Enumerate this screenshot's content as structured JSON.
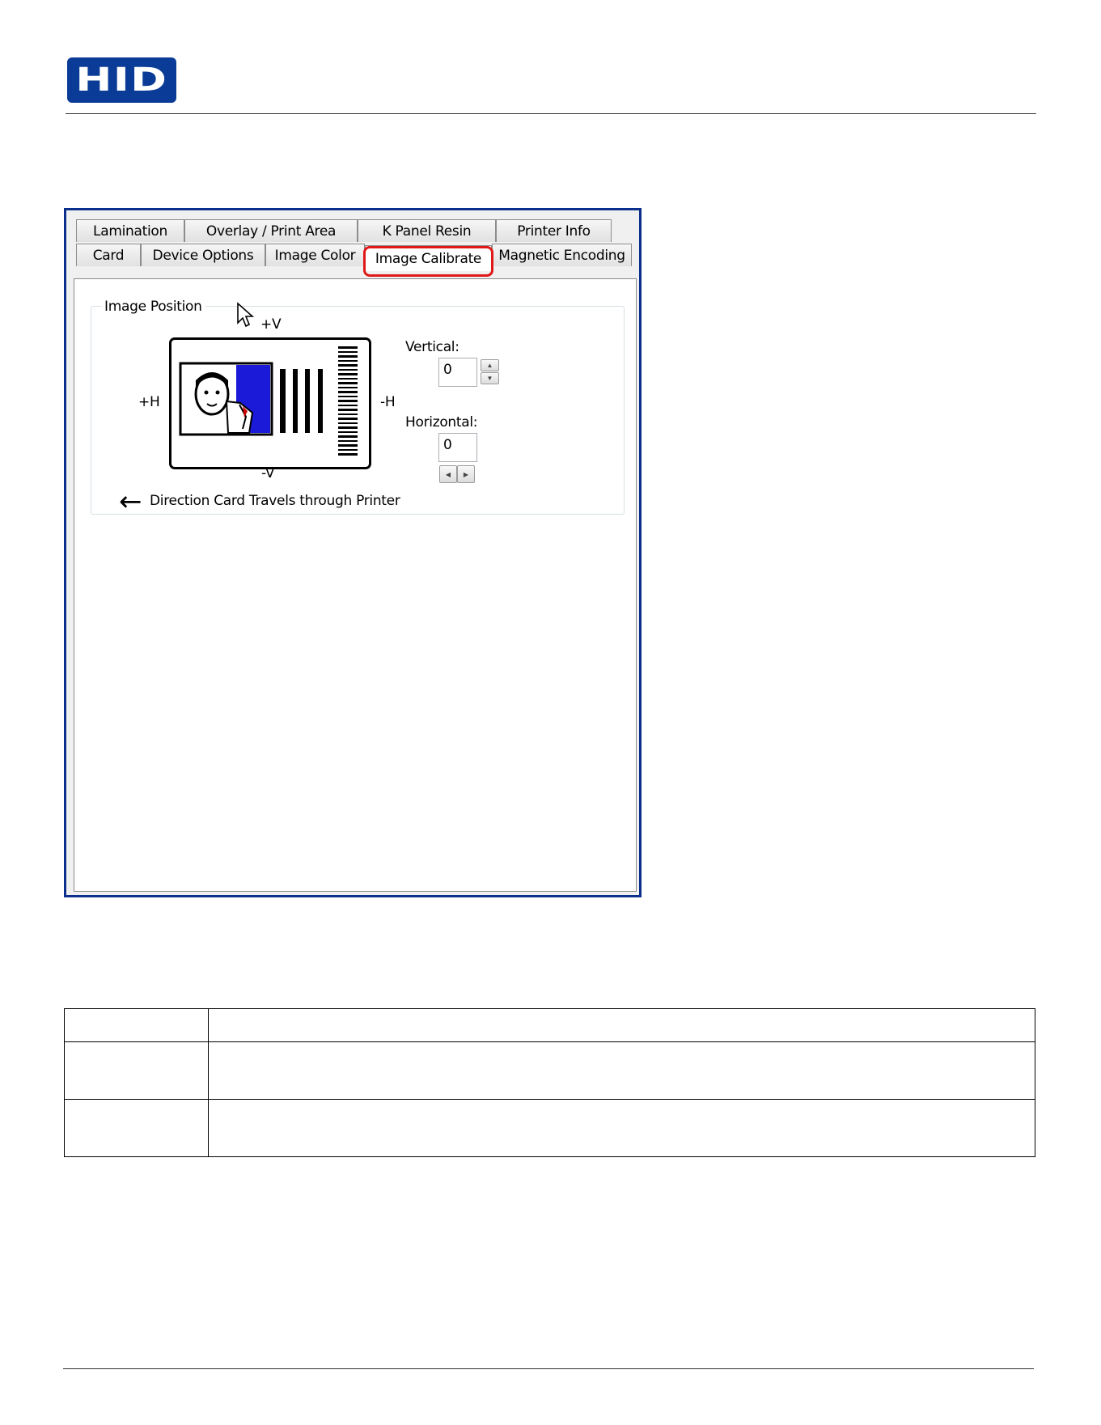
{
  "brand": {
    "logo_text": "HID",
    "logo_color": "#0a3b96"
  },
  "dialog": {
    "tabs_row1": [
      "Lamination",
      "Overlay / Print Area",
      "K Panel Resin",
      "Printer Info"
    ],
    "tabs_row2": [
      "Card",
      "Device Options",
      "Image Color",
      "Image Calibrate",
      "Magnetic Encoding"
    ],
    "active_tab": "Image Calibrate",
    "highlight_color": "#e01818",
    "group_title": "Image Position",
    "label_plus_v": "+V",
    "label_minus_v": "-V",
    "label_plus_h": "+H",
    "label_minus_h": "-H",
    "direction_text": "Direction Card Travels through Printer",
    "vertical_label": "Vertical:",
    "vertical_value": "0",
    "horizontal_label": "Horizontal:",
    "horizontal_value": "0"
  },
  "table": {
    "rows": 3,
    "columns": 2
  }
}
